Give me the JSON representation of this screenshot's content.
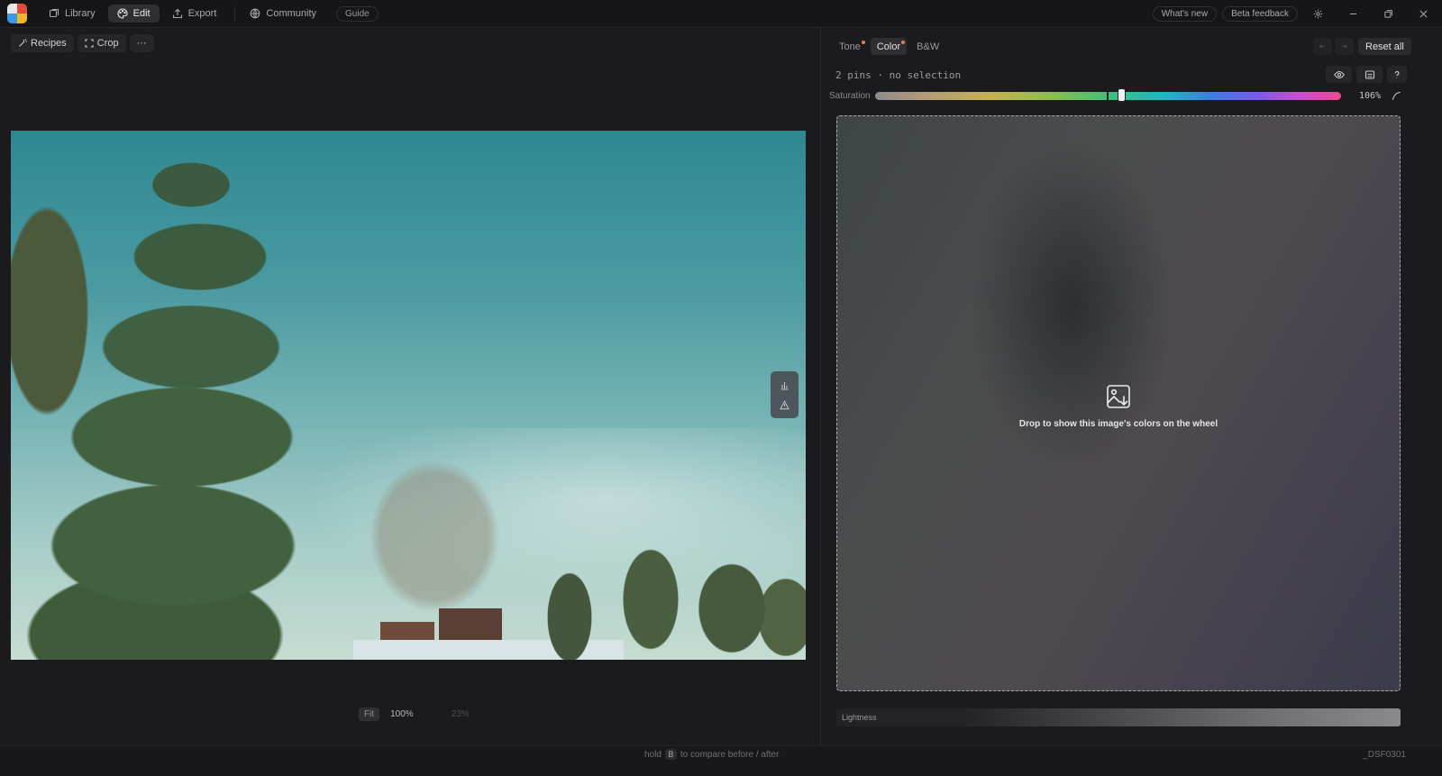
{
  "topbar": {
    "nav": [
      {
        "label": "Library",
        "icon": "library-icon"
      },
      {
        "label": "Edit",
        "icon": "palette-icon",
        "active": true
      },
      {
        "label": "Export",
        "icon": "export-icon"
      },
      {
        "label": "Community",
        "icon": "globe-icon"
      }
    ],
    "guide": "Guide",
    "whats_new": "What's new",
    "beta_feedback": "Beta feedback"
  },
  "left_toolbar": {
    "recipes": "Recipes",
    "crop": "Crop",
    "more": "···"
  },
  "zoom": {
    "fit": "Fit",
    "hundred": "100%",
    "current": "23%"
  },
  "status": {
    "hint_before": "hold",
    "hint_key": "B",
    "hint_after": "to compare before / after",
    "filename": "_DSF0301"
  },
  "panel": {
    "tabs": [
      {
        "label": "Tone",
        "modified": true
      },
      {
        "label": "Color",
        "modified": true,
        "active": true
      },
      {
        "label": "B&W",
        "modified": false
      }
    ],
    "reset_all": "Reset all",
    "pins_text": "2 pins · no selection",
    "saturation": {
      "label": "Saturation",
      "value_text": "106%",
      "value": 106
    },
    "dropzone_text": "Drop to show this image's colors on the wheel",
    "lightness_label": "Lightness"
  },
  "colors": {
    "accent_dot": "#e4824a",
    "active_tab_bg": "#2e2e33"
  }
}
